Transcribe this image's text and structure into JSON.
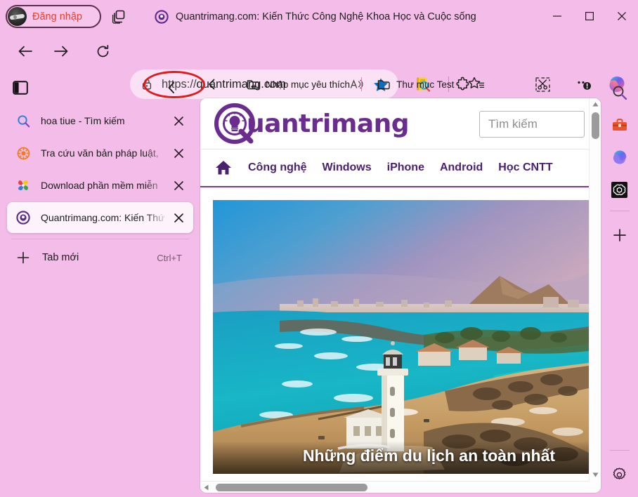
{
  "browser": {
    "profile": {
      "label": "Đăng nhập",
      "icon": "avatar-icon"
    },
    "tab_stack_icon": "tab-stack-icon",
    "window_title": "Quantrimang.com: Kiến Thức Công Nghệ Khoa Học và Cuộc sống",
    "window_controls": {
      "minimize": "minimize-icon",
      "maximize": "maximize-icon",
      "close": "close-icon"
    }
  },
  "toolbar": {
    "back": "back-arrow-icon",
    "forward": "forward-arrow-icon",
    "refresh": "refresh-icon",
    "address": {
      "lock_icon": "lock-icon",
      "scheme": "https://",
      "host": "quantrimang.com",
      "read_aloud_icon": "read-aloud-icon",
      "favorite_icon": "star-filled-icon"
    },
    "icons": [
      {
        "name": "search-extension-icon",
        "label": "Tìm kiếm"
      },
      {
        "name": "extensions-puzzle-icon",
        "label": "Tiện ích mở rộng"
      },
      {
        "name": "favorites-star-icon",
        "label": "Mục yêu thích"
      },
      {
        "name": "web-capture-icon",
        "label": "Chụp màn hình web"
      },
      {
        "name": "settings-more-icon",
        "label": "Cài đặt và khác"
      },
      {
        "name": "copilot-icon",
        "label": "Copilot"
      }
    ]
  },
  "bookmarks_bar": {
    "collapse_icon": "chevron-left-icon",
    "items": [
      {
        "label": "Nhập mục yêu thích",
        "icon": "import-folder-icon"
      },
      {
        "label": "Thư mục Test",
        "icon": "folder-icon"
      }
    ]
  },
  "tab_sidebar": {
    "panel_icon": "sidebar-panel-icon",
    "collapse_icon": "chevron-left-icon",
    "tabs": [
      {
        "title": "hoa tiue - Tìm kiếm",
        "favicon": "search-bing-icon",
        "active": false
      },
      {
        "title": "Tra cứu văn bản pháp luật,",
        "favicon": "dharma-wheel-icon",
        "active": false
      },
      {
        "title": "Download phần mềm miễn",
        "favicon": "pinwheel-icon",
        "active": false
      },
      {
        "title": "Quantrimang.com: Kiến Thứ",
        "favicon": "quantrimang-icon",
        "active": true
      }
    ],
    "new_tab": {
      "label": "Tab mới",
      "shortcut": "Ctrl+T",
      "icon": "plus-icon"
    }
  },
  "edge_sidebar": {
    "items": [
      {
        "name": "search-icon",
        "label": "Tìm kiếm"
      },
      {
        "name": "shopping-bag-icon",
        "label": "Mua sắm"
      },
      {
        "name": "copilot-icon",
        "label": "Copilot"
      },
      {
        "name": "chatgpt-icon",
        "label": "ChatGPT"
      },
      {
        "name": "add-app-icon",
        "label": "Thêm ứng dụng"
      },
      {
        "name": "settings-gear-icon",
        "label": "Cài đặt thanh bên"
      }
    ]
  },
  "webpage": {
    "logo_text": "uantrimang",
    "search_placeholder": "Tìm kiếm",
    "nav": {
      "home_icon": "home-icon",
      "links": [
        "Công nghệ",
        "Windows",
        "iPhone",
        "Android",
        "Học CNTT"
      ]
    },
    "hero": {
      "caption": "Những điểm du lịch an toàn nhất",
      "alt": "Coastal city with lighthouse and turquoise sea"
    }
  },
  "colors": {
    "window_bg": "#f4bce8",
    "address_bg": "#fbe1f5",
    "accent_purple": "#6b2c8f",
    "annotation_red": "#e01b1b",
    "login_red": "#e8402a",
    "star_blue": "#0f6cbd"
  }
}
